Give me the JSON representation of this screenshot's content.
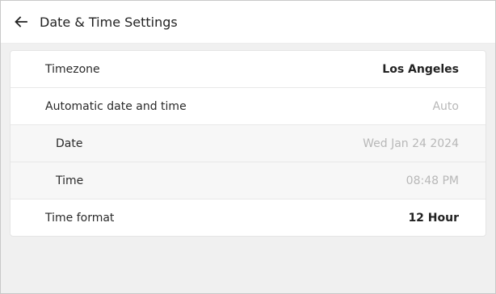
{
  "header": {
    "title": "Date & Time Settings",
    "back_icon": "arrow-left-icon"
  },
  "rows": [
    {
      "label": "Timezone",
      "value": "Los Angeles"
    },
    {
      "label": "Automatic date and time",
      "value": "Auto"
    },
    {
      "label": "Date",
      "value": "Wed Jan 24 2024"
    },
    {
      "label": "Time",
      "value": "08:48 PM"
    },
    {
      "label": "Time format",
      "value": "12 Hour"
    }
  ],
  "colors": {
    "background": "#f0f0f0",
    "card": "#ffffff",
    "sub_row_background": "#f7f7f7",
    "muted_value": "#b8b8b8",
    "text": "#222222"
  }
}
